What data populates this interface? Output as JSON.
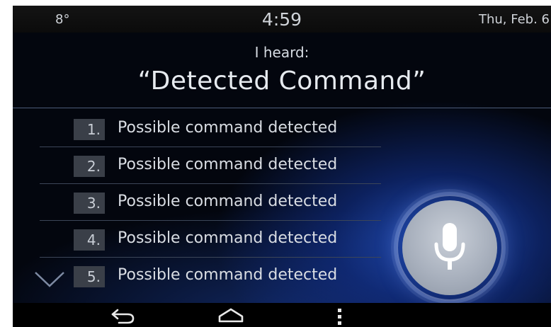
{
  "status_bar": {
    "temperature": "8°",
    "time": "4:59",
    "date": "Thu, Feb. 6"
  },
  "voice": {
    "heard_label": "I heard:",
    "detected_command": "“Detected Command”"
  },
  "commands": [
    {
      "number": "1.",
      "label": "Possible command detected"
    },
    {
      "number": "2.",
      "label": "Possible command detected"
    },
    {
      "number": "3.",
      "label": "Possible command detected"
    },
    {
      "number": "4.",
      "label": "Possible command detected"
    },
    {
      "number": "5.",
      "label": "Possible command detected"
    }
  ],
  "icons": {
    "scroll": "chevron-down-icon",
    "mic": "microphone-icon",
    "back": "back-icon",
    "home": "home-icon",
    "menu": "more-vertical-icon"
  },
  "colors": {
    "background": "#03060e",
    "accent_glow": "#285ad2",
    "text": "#d9dde3",
    "number_box": "#3a3f48"
  }
}
